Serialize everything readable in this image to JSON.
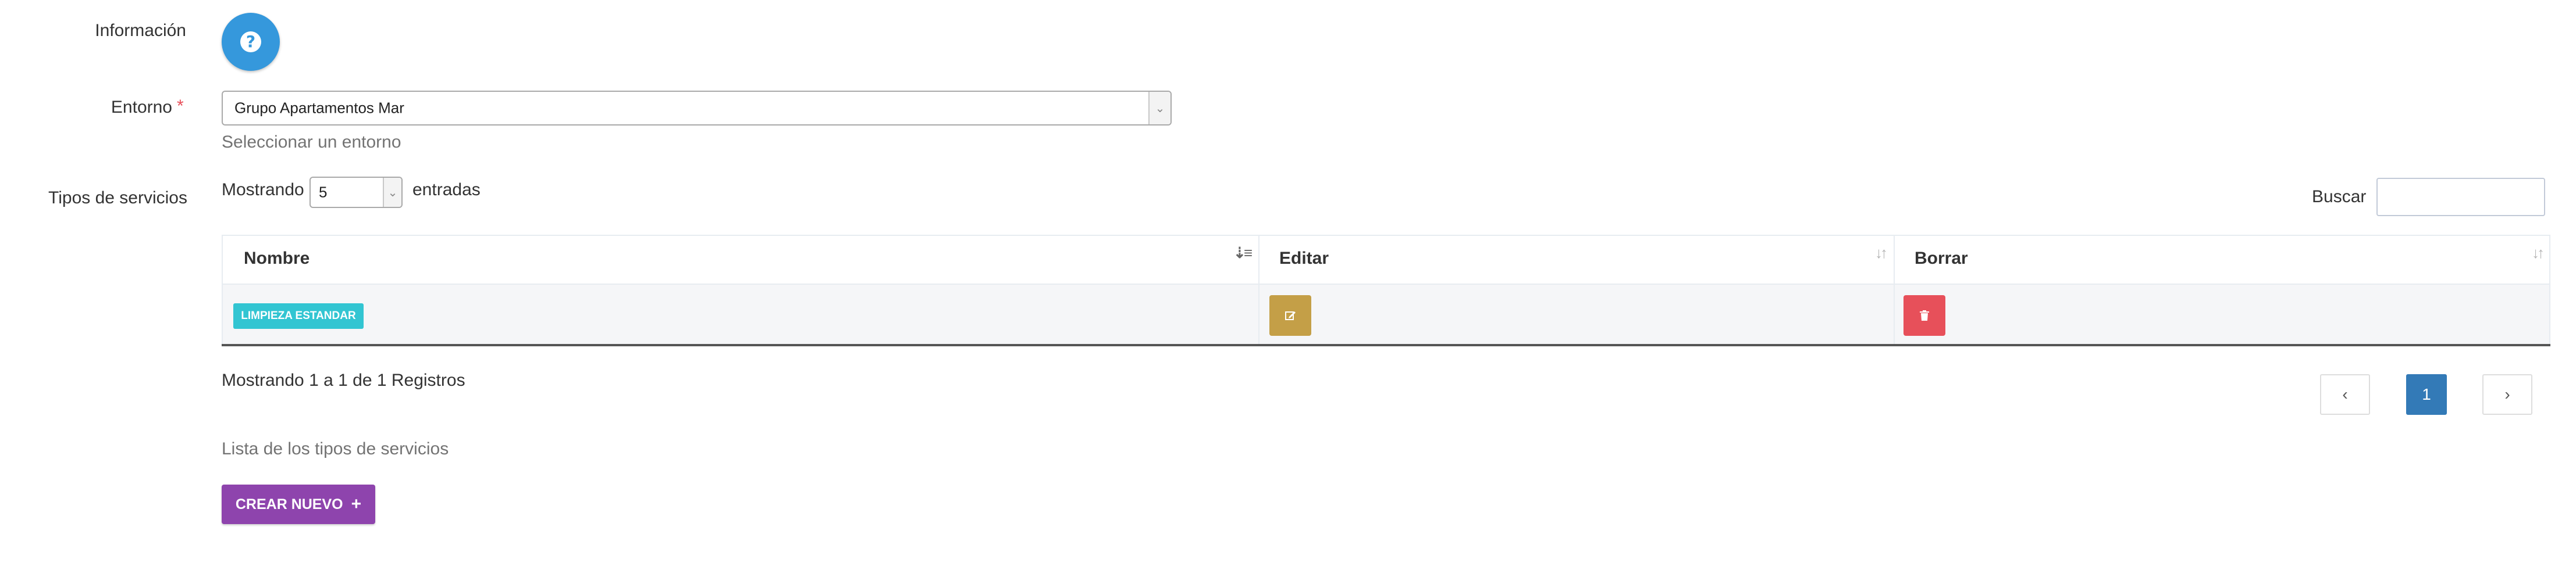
{
  "form": {
    "info_label": "Información",
    "env_label": "Entorno",
    "required_mark": "*",
    "env_value": "Grupo Apartamentos Mar",
    "env_help": "Seleccionar un entorno",
    "services_label": "Tipos de servicios"
  },
  "table_controls": {
    "showing_prefix": "Mostrando",
    "page_size": "5",
    "showing_suffix": "entradas",
    "search_label": "Buscar",
    "search_value": ""
  },
  "table": {
    "columns": [
      "Nombre",
      "Editar",
      "Borrar"
    ],
    "rows": [
      {
        "nombre": "LIMPIEZA ESTANDAR"
      }
    ]
  },
  "footer": {
    "info": "Mostrando 1 a 1 de 1 Registros",
    "pagination": {
      "prev": "‹",
      "current": "1",
      "next": "›"
    },
    "list_help": "Lista de los tipos de servicios",
    "create_label": "CREAR NUEVO",
    "create_icon": "+"
  },
  "colors": {
    "info_button": "#3598dc",
    "badge": "#32c5d2",
    "edit": "#c49f47",
    "delete": "#e7505a",
    "create": "#8e44ad",
    "pagination_active": "#337ab7"
  },
  "icons": [
    "question-icon",
    "chevron-down-icon",
    "sort-icon",
    "edit-icon",
    "trash-icon",
    "chevron-left-icon",
    "chevron-right-icon",
    "plus-icon"
  ]
}
